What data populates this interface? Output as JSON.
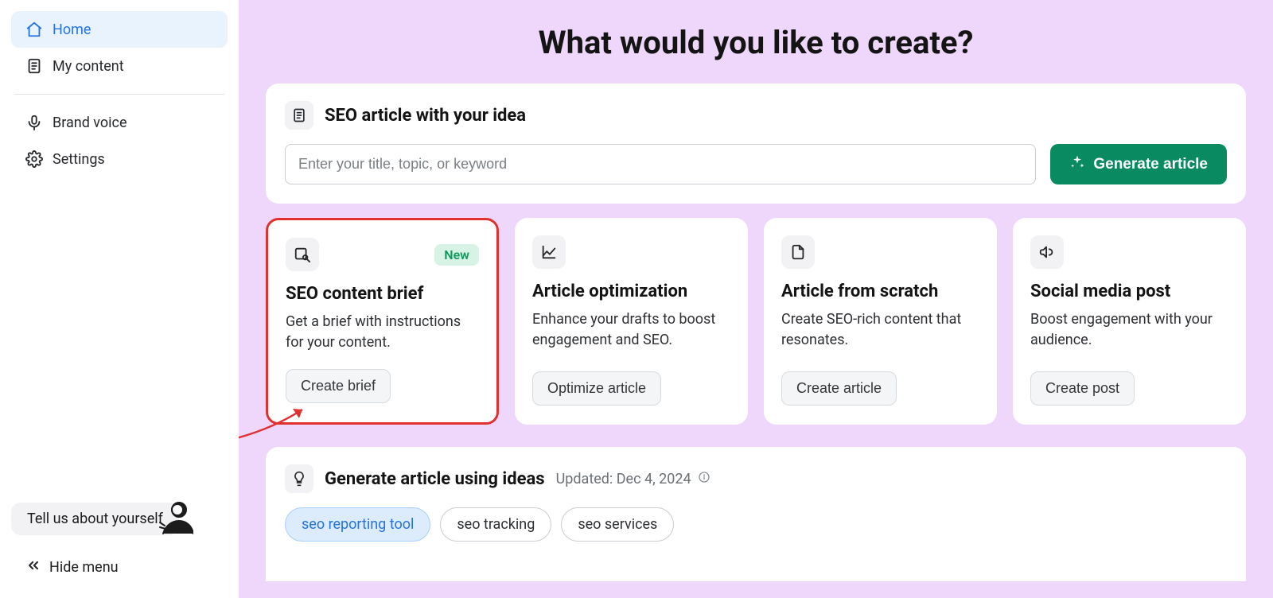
{
  "sidebar": {
    "items": [
      {
        "key": "home",
        "label": "Home"
      },
      {
        "key": "my-content",
        "label": "My content"
      },
      {
        "key": "brand-voice",
        "label": "Brand voice"
      },
      {
        "key": "settings",
        "label": "Settings"
      }
    ],
    "tell_us_label": "Tell us about yourself",
    "hide_menu_label": "Hide menu"
  },
  "page_title": "What would you like to create?",
  "hero": {
    "header": "SEO article with your idea",
    "placeholder": "Enter your title, topic, or keyword",
    "cta": "Generate article"
  },
  "cards": [
    {
      "title": "SEO content brief",
      "desc": "Get a brief with instructions for your content.",
      "btn": "Create brief",
      "badge": "New"
    },
    {
      "title": "Article optimization",
      "desc": "Enhance your drafts to boost engagement and SEO.",
      "btn": "Optimize article"
    },
    {
      "title": "Article from scratch",
      "desc": "Create SEO-rich content that resonates.",
      "btn": "Create article"
    },
    {
      "title": "Social media post",
      "desc": "Boost engagement with your audience.",
      "btn": "Create post"
    }
  ],
  "ideas": {
    "title": "Generate article using ideas",
    "updated_label": "Updated: Dec 4, 2024",
    "chips": [
      {
        "label": "seo reporting tool",
        "selected": true
      },
      {
        "label": "seo tracking",
        "selected": false
      },
      {
        "label": "seo services",
        "selected": false
      }
    ]
  }
}
